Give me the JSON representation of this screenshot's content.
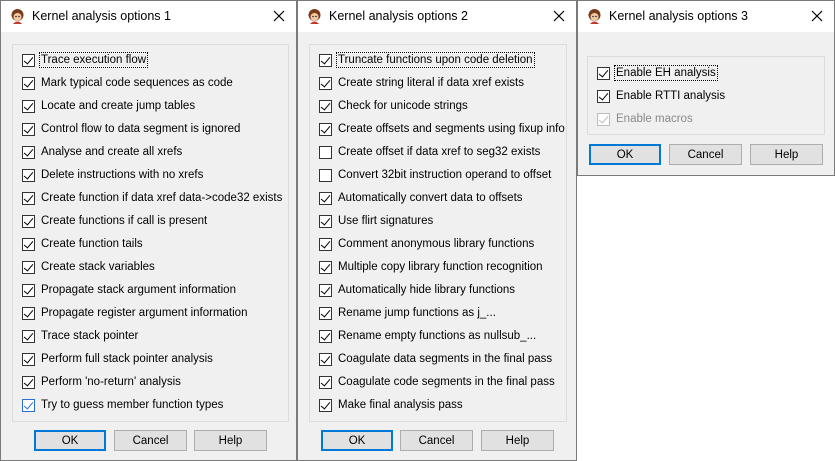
{
  "dialogs": [
    {
      "title": "Kernel analysis options 1",
      "ok_label": "OK",
      "cancel_label": "Cancel",
      "help_label": "Help",
      "options": [
        {
          "label": "Trace execution flow",
          "checked": true,
          "focused": true
        },
        {
          "label": "Mark typical code sequences as code",
          "checked": true
        },
        {
          "label": "Locate and create jump tables",
          "checked": true
        },
        {
          "label": "Control flow to data segment is ignored",
          "checked": true
        },
        {
          "label": "Analyse and create all xrefs",
          "checked": true
        },
        {
          "label": "Delete instructions with no xrefs",
          "checked": true
        },
        {
          "label": "Create function if data xref data->code32 exists",
          "checked": true
        },
        {
          "label": "Create functions if call is present",
          "checked": true
        },
        {
          "label": "Create function tails",
          "checked": true
        },
        {
          "label": "Create stack variables",
          "checked": true
        },
        {
          "label": "Propagate stack argument information",
          "checked": true
        },
        {
          "label": "Propagate register argument information",
          "checked": true
        },
        {
          "label": "Trace stack pointer",
          "checked": true
        },
        {
          "label": "Perform full stack pointer analysis",
          "checked": true
        },
        {
          "label": "Perform 'no-return' analysis",
          "checked": true
        },
        {
          "label": "Try to guess member function types",
          "checked": true,
          "hover": true
        }
      ]
    },
    {
      "title": "Kernel analysis options 2",
      "ok_label": "OK",
      "cancel_label": "Cancel",
      "help_label": "Help",
      "options": [
        {
          "label": "Truncate functions upon code deletion",
          "checked": true,
          "focused": true
        },
        {
          "label": "Create string literal if data xref exists",
          "checked": true
        },
        {
          "label": "Check for unicode strings",
          "checked": true
        },
        {
          "label": "Create offsets and segments using fixup info",
          "checked": true
        },
        {
          "label": "Create offset if data xref to seg32 exists",
          "checked": false
        },
        {
          "label": "Convert 32bit instruction operand to offset",
          "checked": false
        },
        {
          "label": "Automatically convert data to offsets",
          "checked": true
        },
        {
          "label": "Use flirt signatures",
          "checked": true
        },
        {
          "label": "Comment anonymous library functions",
          "checked": true
        },
        {
          "label": "Multiple copy library function recognition",
          "checked": true
        },
        {
          "label": "Automatically hide library functions",
          "checked": true
        },
        {
          "label": "Rename jump functions as j_...",
          "checked": true
        },
        {
          "label": "Rename empty functions as nullsub_...",
          "checked": true
        },
        {
          "label": "Coagulate data segments in the final pass",
          "checked": true
        },
        {
          "label": "Coagulate code segments in the final pass",
          "checked": true
        },
        {
          "label": "Make final analysis pass",
          "checked": true
        }
      ]
    },
    {
      "title": "Kernel analysis options 3",
      "ok_label": "OK",
      "cancel_label": "Cancel",
      "help_label": "Help",
      "options": [
        {
          "label": "Enable EH analysis",
          "checked": true,
          "focused": true
        },
        {
          "label": "Enable RTTI analysis",
          "checked": true
        },
        {
          "label": "Enable macros",
          "checked": true,
          "disabled": true
        }
      ]
    }
  ]
}
